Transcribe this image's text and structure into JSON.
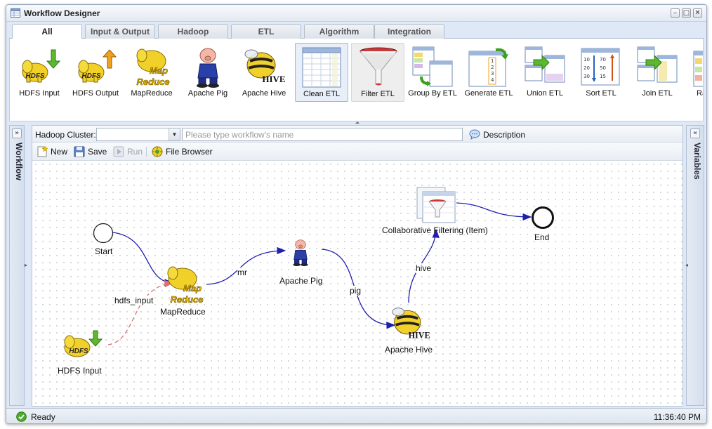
{
  "window": {
    "title": "Workflow Designer",
    "controls": {
      "minimize": "–",
      "maximize": "□",
      "close": "✕"
    }
  },
  "tabs": [
    {
      "label": "All",
      "active": true
    },
    {
      "label": "Input & Output",
      "active": false
    },
    {
      "label": "Hadoop",
      "active": false
    },
    {
      "label": "ETL",
      "active": false
    },
    {
      "label": "Algorithm",
      "active": false
    },
    {
      "label": "Integration",
      "active": false
    }
  ],
  "palette": {
    "items": [
      {
        "label": "HDFS Input",
        "icon": "hdfs-input-icon"
      },
      {
        "label": "HDFS Output",
        "icon": "hdfs-output-icon"
      },
      {
        "label": "MapReduce",
        "icon": "mapreduce-icon"
      },
      {
        "label": "Apache Pig",
        "icon": "apache-pig-icon"
      },
      {
        "label": "Apache Hive",
        "icon": "apache-hive-icon"
      },
      {
        "label": "Clean ETL",
        "icon": "clean-etl-icon",
        "state": "selected"
      },
      {
        "label": "Filter ETL",
        "icon": "filter-etl-icon",
        "state": "hovered"
      },
      {
        "label": "Group By ETL",
        "icon": "group-by-etl-icon"
      },
      {
        "label": "Generate ETL",
        "icon": "generate-etl-icon"
      },
      {
        "label": "Union ETL",
        "icon": "union-etl-icon"
      },
      {
        "label": "Sort ETL",
        "icon": "sort-etl-icon"
      },
      {
        "label": "Join ETL",
        "icon": "join-etl-icon"
      },
      {
        "label": "Ra",
        "icon": "partial-tool-icon"
      }
    ]
  },
  "left_panel": {
    "label": "Workflow",
    "collapse_glyph": "»"
  },
  "right_panel": {
    "label": "Variables",
    "collapse_glyph": "«"
  },
  "form": {
    "cluster_label": "Hadoop Cluster:",
    "cluster_value": "",
    "workflow_name_value": "",
    "workflow_name_placeholder": "Please type workflow's name",
    "description_label": "Description"
  },
  "toolbar": {
    "new_label": "New",
    "save_label": "Save",
    "run_label": "Run",
    "file_browser_label": "File Browser"
  },
  "workflow": {
    "nodes": {
      "start": "Start",
      "mapreduce": "MapReduce",
      "hdfs_input": "HDFS Input",
      "pig": "Apache Pig",
      "hive": "Apache Hive",
      "cf": "Collaborative Filtering (Item)",
      "end": "End"
    },
    "edges": {
      "hdfs_input": "hdfs_input",
      "mr": "mr",
      "pig": "pig",
      "hive": "hive"
    }
  },
  "status": {
    "text": "Ready",
    "time": "11:36:40 PM"
  },
  "colors": {
    "flow_edge": "#1f1fb0",
    "data_edge": "#e07070",
    "hadoop_yellow": "#f2d02a",
    "window_bg": "#dfe8f6"
  }
}
